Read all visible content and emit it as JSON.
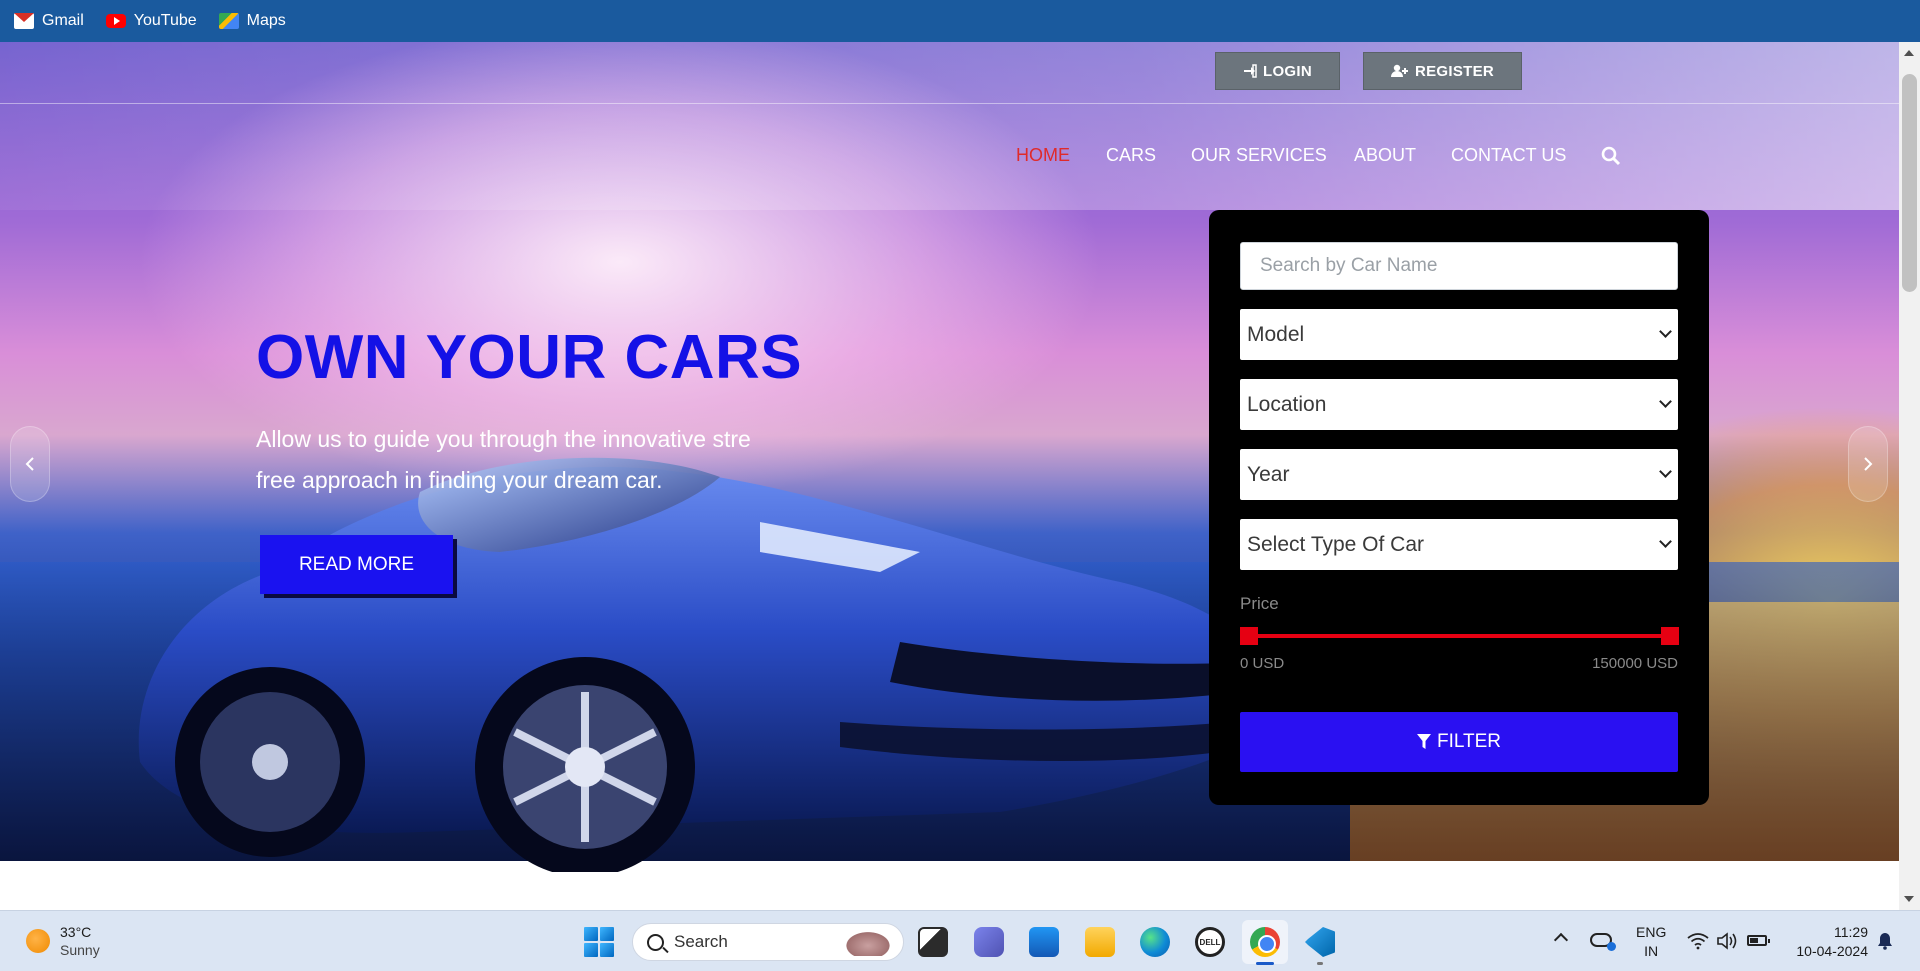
{
  "bookmarks": [
    {
      "label": "Gmail",
      "icon": "gmail-icon"
    },
    {
      "label": "YouTube",
      "icon": "youtube-icon"
    },
    {
      "label": "Maps",
      "icon": "maps-icon"
    }
  ],
  "header": {
    "login_label": "LOGIN",
    "register_label": "REGISTER",
    "nav": [
      {
        "label": "HOME",
        "active": true
      },
      {
        "label": "CARS",
        "active": false
      },
      {
        "label": "OUR SERVICES",
        "active": false
      },
      {
        "label": "ABOUT",
        "active": false
      },
      {
        "label": "CONTACT US",
        "active": false
      }
    ],
    "active_color": "#e02a2a"
  },
  "hero": {
    "title": "OWN YOUR CARS",
    "subtitle_line1": "Allow us to guide you through the innovative stre",
    "subtitle_line2": "free approach in finding your dream car.",
    "read_more_label": "READ MORE",
    "title_color": "#1411e6",
    "button_color": "#1a12f0"
  },
  "filter": {
    "search_placeholder": "Search by Car Name",
    "model_selected": "Model",
    "location_selected": "Location",
    "year_selected": "Year",
    "type_selected": "Select Type Of Car",
    "price_label": "Price",
    "price_min": "0 USD",
    "price_max": "150000 USD",
    "filter_label": "FILTER",
    "slider_color": "#e60012",
    "button_color": "#2a10f2"
  },
  "taskbar": {
    "temperature": "33°C",
    "condition": "Sunny",
    "search_label": "Search",
    "dell_label": "DELL",
    "lang_top": "ENG",
    "lang_bottom": "IN",
    "time": "11:29",
    "date": "10-04-2024"
  }
}
